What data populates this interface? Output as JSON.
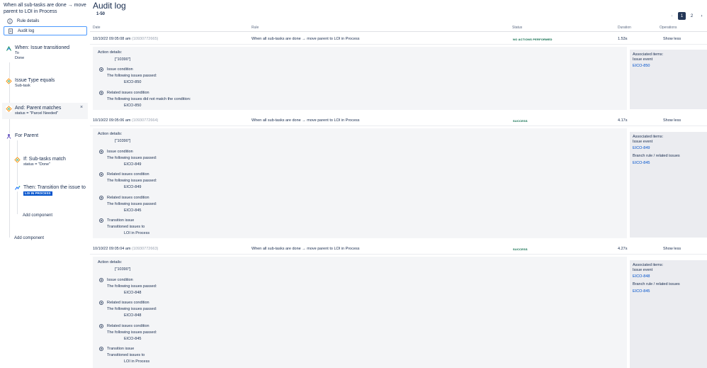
{
  "sidebar": {
    "rule_title": "When all sub-tasks are done → move parent to LOI in Process",
    "nav": {
      "rule_details": "Rule details",
      "audit_log": "Audit log"
    },
    "components": {
      "trigger": {
        "title": "When: Issue transitioned",
        "line1": "To",
        "line2": "Done"
      },
      "cond1": {
        "title": "Issue Type equals",
        "sub": "Sub-task"
      },
      "cond2": {
        "title": "And: Parent matches",
        "sub": "status = \"Parcel Needed\"",
        "close": "×"
      },
      "branch": {
        "title": "For Parent"
      },
      "cond3": {
        "title": "If: Sub-tasks match",
        "sub": "status = \"Done\""
      },
      "action": {
        "title": "Then: Transition the issue to",
        "badge": "LOI IN PROCESS"
      },
      "add_inner": "Add component",
      "add_outer": "Add component"
    }
  },
  "main": {
    "title": "Audit log",
    "range": "1-50",
    "pagination": {
      "prev": "‹",
      "pages": [
        "1",
        "2"
      ],
      "next": "›"
    },
    "columns": {
      "date": "Date",
      "rule": "Rule",
      "status": "Status",
      "duration": "Duration",
      "operations": "Operations"
    },
    "entries": [
      {
        "date": "10/10/22 09:05:08 am",
        "id": "(10930772665)",
        "rule": "When all sub-tasks are done → move parent to LOI in Process",
        "status": "NO ACTIONS PERFORMED",
        "duration": "1.53s",
        "op": "Show less",
        "action_details": "Action details:",
        "action_value": "[\"10390\"]",
        "steps": [
          {
            "title": "Issue condition",
            "desc": "The following issues passed:",
            "item": "EICO-850"
          },
          {
            "title": "Related issues condition",
            "desc": "The following issues did not match the condition:",
            "item": "EICO-850"
          }
        ],
        "assoc": {
          "title": "Associated items:",
          "event": "Issue event",
          "links": [
            "EICO-850"
          ]
        }
      },
      {
        "date": "10/10/22 09:05:06 am",
        "id": "(10930772664)",
        "rule": "When all sub-tasks are done → move parent to LOI in Process",
        "status": "SUCCESS",
        "duration": "4.17s",
        "op": "Show less",
        "action_details": "Action details:",
        "action_value": "[\"10390\"]",
        "steps": [
          {
            "title": "Issue condition",
            "desc": "The following issues passed:",
            "item": "EICO-849"
          },
          {
            "title": "Related issues condition",
            "desc": "The following issues passed:",
            "item": "EICO-849"
          },
          {
            "title": "Related issues condition",
            "desc": "The following issues passed:",
            "item": "EICO-845"
          },
          {
            "title": "Transition issue",
            "desc": "Transitioned issues to",
            "item": "LOI in Process"
          }
        ],
        "assoc": {
          "title": "Associated items:",
          "event": "Issue event",
          "links": [
            "EICO-849"
          ],
          "branch": "Branch rule / related issues",
          "branch_link": "EICO-845"
        }
      },
      {
        "date": "10/10/22 09:05:04 am",
        "id": "(10930772663)",
        "rule": "When all sub-tasks are done → move parent to LOI in Process",
        "status": "SUCCESS",
        "duration": "4.27s",
        "op": "Show less",
        "action_details": "Action details:",
        "action_value": "[\"10390\"]",
        "steps": [
          {
            "title": "Issue condition",
            "desc": "The following issues passed:",
            "item": "EICO-848"
          },
          {
            "title": "Related issues condition",
            "desc": "The following issues passed:",
            "item": "EICO-848"
          },
          {
            "title": "Related issues condition",
            "desc": "The following issues passed:",
            "item": "EICO-845"
          },
          {
            "title": "Transition issue",
            "desc": "Transitioned issues to",
            "item": "LOI in Process"
          }
        ],
        "assoc": {
          "title": "Associated items:",
          "event": "Issue event",
          "links": [
            "EICO-848"
          ],
          "branch": "Branch rule / related issues",
          "branch_link": "EICO-845"
        }
      }
    ]
  },
  "colors": {
    "accent": "#0052cc",
    "success": "#006644",
    "panel": "#f4f5f7"
  }
}
